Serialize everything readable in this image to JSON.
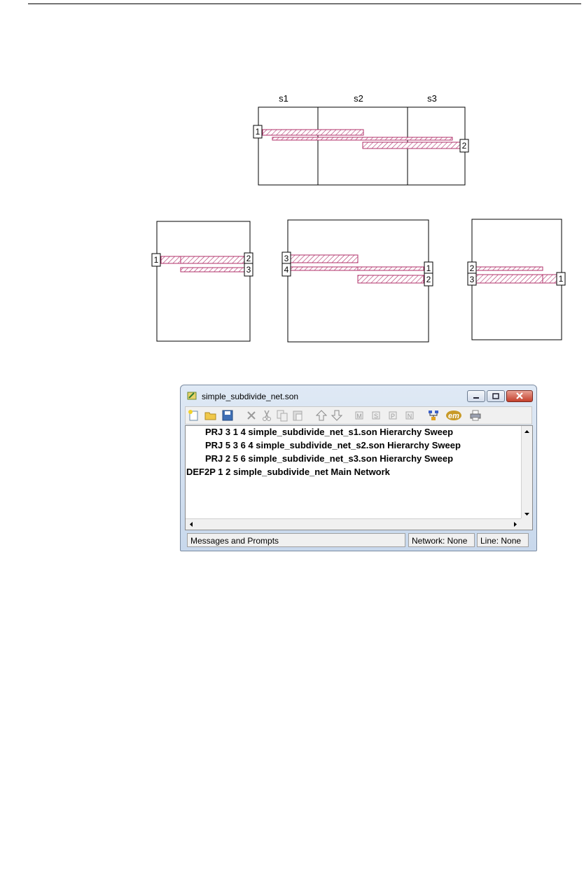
{
  "diagram": {
    "section_labels": [
      "s1",
      "s2",
      "s3"
    ],
    "top_ports": [
      "1",
      "2"
    ],
    "left_ports": [
      "1",
      "2",
      "3"
    ],
    "middle_ports": [
      "3",
      "4",
      "1",
      "2"
    ],
    "right_ports": [
      "2",
      "3",
      "1"
    ]
  },
  "window": {
    "title": "simple_subdivide_net.son",
    "lines": [
      "PRJ 3 1 4 simple_subdivide_net_s1.son Hierarchy Sweep",
      "PRJ 5 3 6 4 simple_subdivide_net_s2.son Hierarchy Sweep",
      "PRJ 2 5 6 simple_subdivide_net_s3.son Hierarchy Sweep",
      "DEF2P 1 2 simple_subdivide_net Main Network"
    ],
    "status": {
      "messages": "Messages and Prompts",
      "network": "Network: None",
      "line": "Line: None"
    },
    "toolbar_icons": [
      "new-icon",
      "open-icon",
      "save-icon",
      "delete-icon",
      "cut-icon",
      "copy-icon",
      "paste-icon",
      "up-arrow-icon",
      "down-arrow-icon",
      "m-icon",
      "s-icon",
      "p-icon",
      "n-icon",
      "network-icon",
      "em-icon",
      "print-icon"
    ],
    "toolbar_letters": [
      "M",
      "S",
      "P",
      "N"
    ],
    "em_label": "em"
  }
}
